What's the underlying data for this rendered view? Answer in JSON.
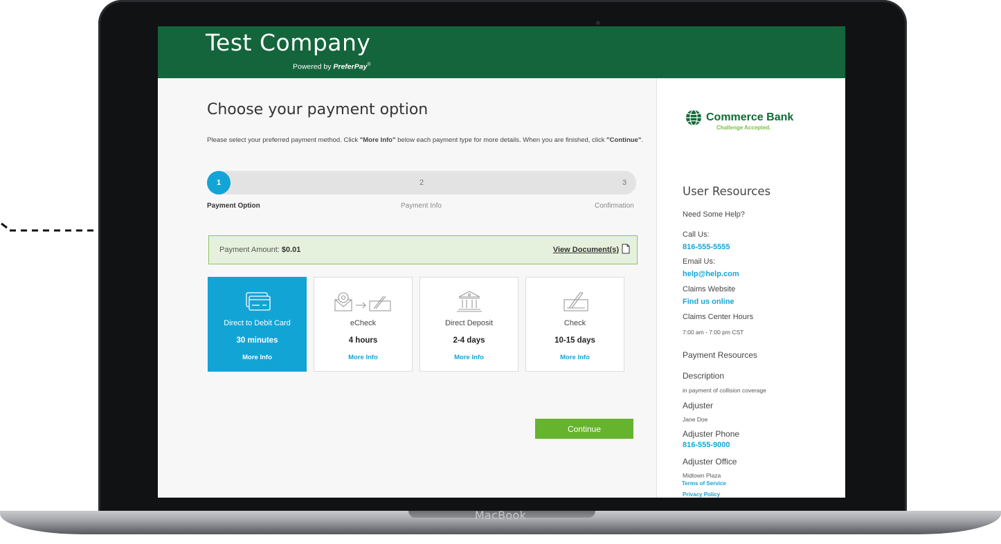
{
  "device": {
    "label": "MacBook"
  },
  "header": {
    "company": "Test Company",
    "powered_prefix": "Powered by",
    "powered_brand": "PreferPay",
    "powered_mark": "®"
  },
  "main": {
    "title": "Choose your payment option",
    "instructions_a": "Please select your preferred payment method. Click ",
    "instructions_b": "\"More Info\"",
    "instructions_c": " below each payment type for more details. When you are finished, click ",
    "instructions_d": "\"Continue\"",
    "instructions_e": ".",
    "steps": [
      {
        "number": "1",
        "label": "Payment Option",
        "active": true
      },
      {
        "number": "2",
        "label": "Payment Info",
        "active": false
      },
      {
        "number": "3",
        "label": "Confirmation",
        "active": false
      }
    ],
    "amount_label": "Payment Amount: ",
    "amount_value": "$0.01",
    "view_documents": "View Document(s)",
    "options": [
      {
        "name": "Direct to Debit Card",
        "time": "30 minutes",
        "more": "More Info",
        "icon": "debit-card-icon",
        "selected": true
      },
      {
        "name": "eCheck",
        "time": "4 hours",
        "more": "More Info",
        "icon": "email-to-check-icon",
        "selected": false
      },
      {
        "name": "Direct Deposit",
        "time": "2-4 days",
        "more": "More Info",
        "icon": "bank-icon",
        "selected": false
      },
      {
        "name": "Check",
        "time": "10-15 days",
        "more": "More Info",
        "icon": "check-icon",
        "selected": false
      }
    ],
    "continue_label": "Continue"
  },
  "sidebar": {
    "bank_name": "Commerce Bank",
    "bank_tagline": "Challenge Accepted.",
    "user_resources": "User Resources",
    "need_help": "Need Some Help?",
    "call_us_label": "Call Us:",
    "call_us_value": "816-555-5555",
    "email_us_label": "Email Us:",
    "email_us_value": "help@help.com",
    "claims_website_label": "Claims Website",
    "claims_website_value": "Find us online",
    "claims_hours_label": "Claims Center Hours",
    "claims_hours_value": "7:00 am - 7:00 pm CST",
    "payment_resources": "Payment Resources",
    "description_label": "Description",
    "description_value": "in payment of collision coverage",
    "adjuster_label": "Adjuster",
    "adjuster_value": "Jane Doe",
    "adjuster_phone_label": "Adjuster Phone",
    "adjuster_phone_value": "816-555-9000",
    "adjuster_office_label": "Adjuster Office",
    "adjuster_office_value": "Midtown Plaza",
    "privacy_policy": "Privacy Policy",
    "terms_of_service": "Terms of Service"
  },
  "colors": {
    "header_green": "#14653b",
    "accent_blue": "#13a4d6",
    "continue_green": "#66b32e",
    "amount_bg": "#e5f1dc"
  }
}
